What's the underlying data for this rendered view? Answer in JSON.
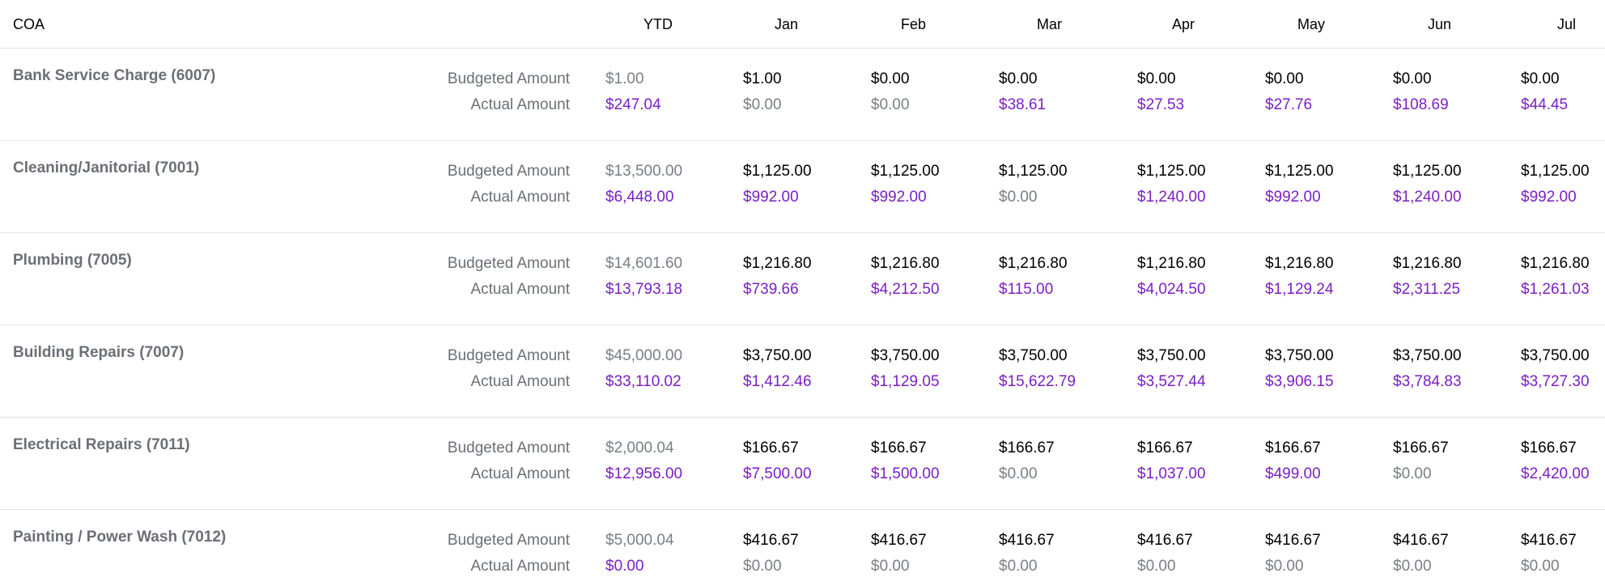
{
  "header": {
    "coa": "COA",
    "months": [
      "YTD",
      "Jan",
      "Feb",
      "Mar",
      "Apr",
      "May",
      "Jun",
      "Jul"
    ]
  },
  "labels": {
    "budgeted": "Budgeted Amount",
    "actual": "Actual Amount"
  },
  "colors": {
    "muted": "#7a7e84",
    "value": "#000000",
    "actual_nonzero": "#7a1fc4",
    "divider": "#e2e2e2"
  },
  "rows": [
    {
      "name": "Bank Service Charge (6007)",
      "budgeted": [
        "$1.00",
        "$1.00",
        "$0.00",
        "$0.00",
        "$0.00",
        "$0.00",
        "$0.00",
        "$0.00"
      ],
      "actual": [
        "$247.04",
        "$0.00",
        "$0.00",
        "$38.61",
        "$27.53",
        "$27.76",
        "$108.69",
        "$44.45"
      ]
    },
    {
      "name": "Cleaning/Janitorial (7001)",
      "budgeted": [
        "$13,500.00",
        "$1,125.00",
        "$1,125.00",
        "$1,125.00",
        "$1,125.00",
        "$1,125.00",
        "$1,125.00",
        "$1,125.00"
      ],
      "actual": [
        "$6,448.00",
        "$992.00",
        "$992.00",
        "$0.00",
        "$1,240.00",
        "$992.00",
        "$1,240.00",
        "$992.00"
      ]
    },
    {
      "name": "Plumbing (7005)",
      "budgeted": [
        "$14,601.60",
        "$1,216.80",
        "$1,216.80",
        "$1,216.80",
        "$1,216.80",
        "$1,216.80",
        "$1,216.80",
        "$1,216.80"
      ],
      "actual": [
        "$13,793.18",
        "$739.66",
        "$4,212.50",
        "$115.00",
        "$4,024.50",
        "$1,129.24",
        "$2,311.25",
        "$1,261.03"
      ]
    },
    {
      "name": "Building Repairs (7007)",
      "budgeted": [
        "$45,000.00",
        "$3,750.00",
        "$3,750.00",
        "$3,750.00",
        "$3,750.00",
        "$3,750.00",
        "$3,750.00",
        "$3,750.00"
      ],
      "actual": [
        "$33,110.02",
        "$1,412.46",
        "$1,129.05",
        "$15,622.79",
        "$3,527.44",
        "$3,906.15",
        "$3,784.83",
        "$3,727.30"
      ]
    },
    {
      "name": "Electrical Repairs (7011)",
      "budgeted": [
        "$2,000.04",
        "$166.67",
        "$166.67",
        "$166.67",
        "$166.67",
        "$166.67",
        "$166.67",
        "$166.67"
      ],
      "actual": [
        "$12,956.00",
        "$7,500.00",
        "$1,500.00",
        "$0.00",
        "$1,037.00",
        "$499.00",
        "$0.00",
        "$2,420.00"
      ]
    },
    {
      "name": "Painting / Power Wash (7012)",
      "budgeted": [
        "$5,000.04",
        "$416.67",
        "$416.67",
        "$416.67",
        "$416.67",
        "$416.67",
        "$416.67",
        "$416.67"
      ],
      "actual": [
        "$0.00",
        "$0.00",
        "$0.00",
        "$0.00",
        "$0.00",
        "$0.00",
        "$0.00",
        "$0.00"
      ]
    }
  ]
}
